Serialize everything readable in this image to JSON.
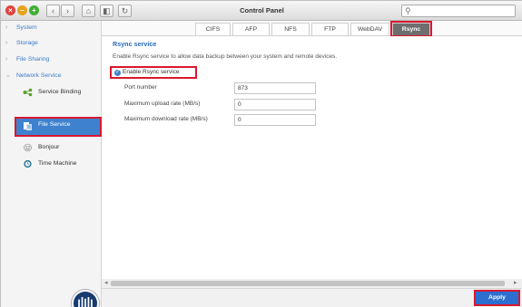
{
  "window": {
    "title": "Control Panel"
  },
  "titlebar": {
    "close_icon": "close-icon",
    "minimize_icon": "minimize-icon",
    "maximize_icon": "maximize-icon",
    "back_label": "‹",
    "forward_label": "›",
    "home_label": "⌂",
    "sidebar_toggle_label": "◧",
    "refresh_label": "↻",
    "search_placeholder": ""
  },
  "sidebar": {
    "items": [
      {
        "label": "System"
      },
      {
        "label": "Storage"
      },
      {
        "label": "File Sharing"
      },
      {
        "label": "Network Service"
      }
    ],
    "subitems": [
      {
        "label": "Service Binding"
      },
      {
        "label": "File Service"
      },
      {
        "label": "Bonjour"
      },
      {
        "label": "Time Machine"
      }
    ]
  },
  "tabs": [
    {
      "label": "CIFS"
    },
    {
      "label": "AFP"
    },
    {
      "label": "NFS"
    },
    {
      "label": "FTP"
    },
    {
      "label": "WebDAV"
    },
    {
      "label": "Rsync"
    }
  ],
  "content": {
    "title": "Rsync service",
    "description": "Enable Rsync service to allow data backup between your system and remote devices.",
    "enable_label": "Enable Rsync service",
    "enable_checked": true,
    "fields": [
      {
        "label": "Port number",
        "value": "873"
      },
      {
        "label": "Maximum upload rate (MB/s)",
        "value": "0"
      },
      {
        "label": "Maximum download rate (MB/s)",
        "value": "0"
      }
    ]
  },
  "footer": {
    "apply_label": "Apply"
  },
  "colors": {
    "accent": "#3e82cf",
    "highlight": "#d9182d",
    "apply": "#2d6fd1"
  }
}
